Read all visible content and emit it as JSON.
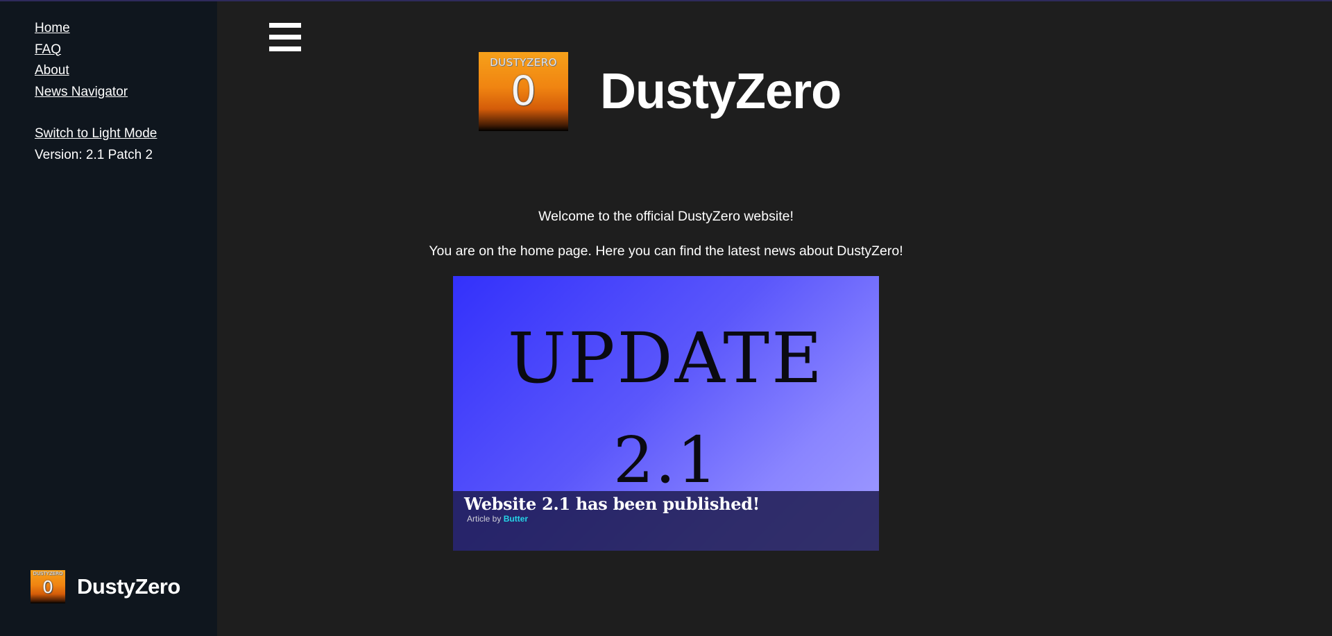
{
  "sidebar": {
    "nav": [
      {
        "label": "Home"
      },
      {
        "label": "FAQ"
      },
      {
        "label": "About"
      },
      {
        "label": "News Navigator"
      }
    ],
    "theme_toggle": "Switch to Light Mode",
    "version": "Version: 2.1 Patch 2",
    "brand": {
      "name": "DustyZero",
      "logo_text": "DUSTYZERO",
      "logo_digit": "0"
    }
  },
  "header": {
    "menu_icon": "hamburger-menu-icon",
    "title": "DustyZero",
    "logo_text": "DUSTYZERO",
    "logo_digit": "0"
  },
  "main": {
    "welcome": "Welcome to the official DustyZero website!",
    "info": "You are on the home page. Here you can find the latest news about DustyZero!",
    "news": {
      "image_line1": "UPDATE",
      "image_line2": "2.1",
      "headline": "Website 2.1 has been published!",
      "byline_prefix": "Article by",
      "author": "Butter"
    }
  },
  "colors": {
    "background": "#1e1e1e",
    "sidebar": "#0f161e",
    "author_accent": "#25d6e8",
    "news_gradient_start": "#3331fb",
    "news_gradient_end": "#a19dff"
  }
}
